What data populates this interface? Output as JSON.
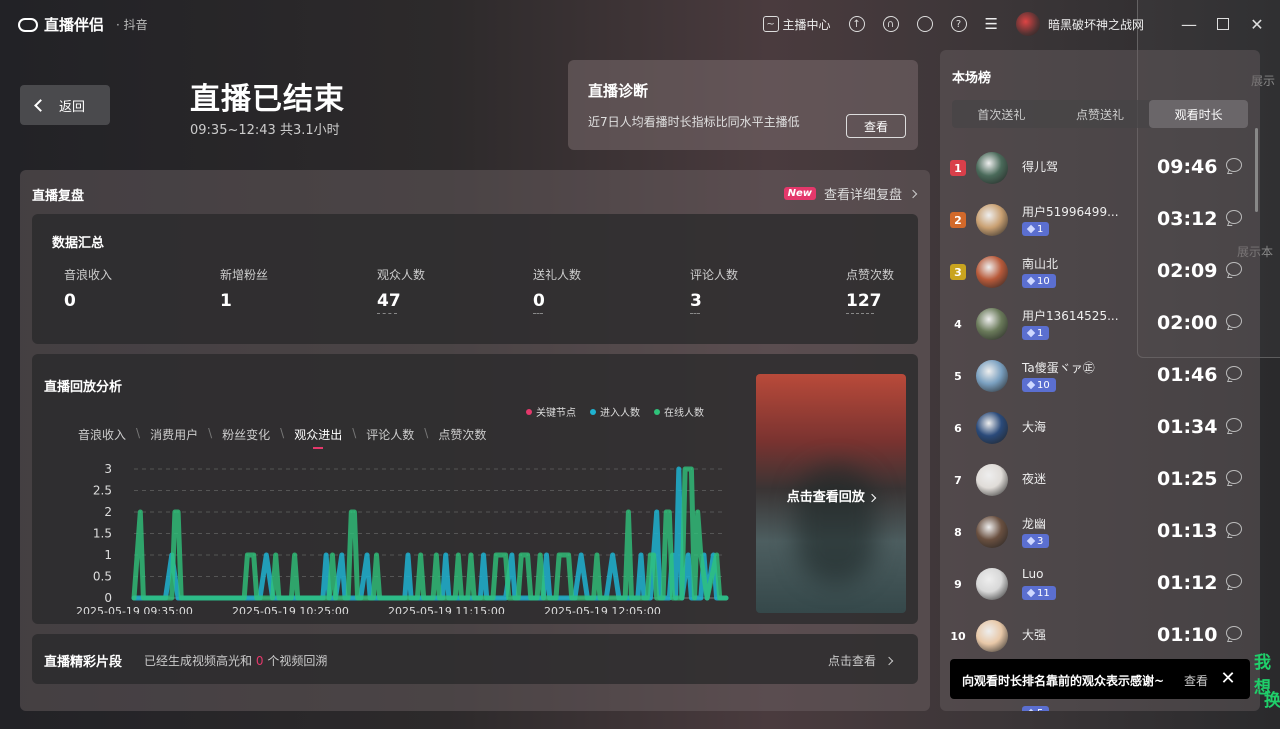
{
  "titlebar": {
    "app_name": "直播伴侣",
    "platform": "· 抖音",
    "anchor_center": "主播中心",
    "username": "暗黑破坏神之战网"
  },
  "header": {
    "back_label": "返回",
    "title": "直播已结束",
    "time_range": "09:35~12:43 共3.1小时"
  },
  "diagnosis": {
    "title": "直播诊断",
    "desc": "近7日人均看播时长指标比同水平主播低",
    "button": "查看"
  },
  "review": {
    "title": "直播复盘",
    "new_badge": "New",
    "detail_link": "查看详细复盘"
  },
  "summary": {
    "title": "数据汇总",
    "stats": [
      {
        "label": "音浪收入",
        "value": "0"
      },
      {
        "label": "新增粉丝",
        "value": "1"
      },
      {
        "label": "观众人数",
        "value": "47"
      },
      {
        "label": "送礼人数",
        "value": "0"
      },
      {
        "label": "评论人数",
        "value": "3"
      },
      {
        "label": "点赞次数",
        "value": "127"
      }
    ]
  },
  "analysis": {
    "title": "直播回放分析",
    "legend": [
      {
        "name": "关键节点",
        "color": "#e4386b"
      },
      {
        "name": "进入人数",
        "color": "#1fb2d0"
      },
      {
        "name": "在线人数",
        "color": "#2fc27a"
      }
    ],
    "tabs": [
      "音浪收入",
      "消费用户",
      "粉丝变化",
      "观众进出",
      "评论人数",
      "点赞次数"
    ],
    "active_tab": 3,
    "replay_label": "点击查看回放"
  },
  "chart_data": {
    "type": "line",
    "title": "",
    "xlabel": "",
    "ylabel": "",
    "x_tick_labels": [
      "2025-05-19 09:35:00",
      "2025-05-19 10:25:00",
      "2025-05-19 11:15:00",
      "2025-05-19 12:05:00"
    ],
    "y_tick_labels": [
      "0",
      "0.5",
      "1",
      "1.5",
      "2",
      "2.5",
      "3"
    ],
    "ylim": [
      0,
      3
    ],
    "x_minutes_range": [
      0,
      188
    ],
    "grid": true,
    "series": [
      {
        "name": "进入人数",
        "color": "#1fb2d0",
        "points": [
          [
            0,
            0
          ],
          [
            10,
            0
          ],
          [
            12,
            1
          ],
          [
            14,
            0
          ],
          [
            40,
            0
          ],
          [
            42,
            1
          ],
          [
            44,
            0
          ],
          [
            60,
            0
          ],
          [
            61,
            1
          ],
          [
            62,
            0
          ],
          [
            64,
            0
          ],
          [
            66,
            1
          ],
          [
            67,
            0
          ],
          [
            72,
            0
          ],
          [
            74,
            1
          ],
          [
            75,
            0
          ],
          [
            86,
            0
          ],
          [
            87,
            1
          ],
          [
            88,
            0
          ],
          [
            98,
            0
          ],
          [
            99,
            1
          ],
          [
            100,
            0
          ],
          [
            110,
            0
          ],
          [
            111,
            1
          ],
          [
            112,
            0
          ],
          [
            118,
            0
          ],
          [
            120,
            1
          ],
          [
            121,
            0
          ],
          [
            130,
            0
          ],
          [
            131,
            1
          ],
          [
            132,
            0
          ],
          [
            140,
            0
          ],
          [
            142,
            1
          ],
          [
            144,
            0
          ],
          [
            150,
            0
          ],
          [
            152,
            1
          ],
          [
            154,
            0
          ],
          [
            160,
            0
          ],
          [
            161,
            1
          ],
          [
            162,
            0
          ],
          [
            164,
            0
          ],
          [
            166,
            2
          ],
          [
            167,
            0
          ],
          [
            170,
            0
          ],
          [
            171,
            1
          ],
          [
            172,
            0
          ],
          [
            173,
            3
          ],
          [
            174,
            0
          ],
          [
            176,
            1
          ],
          [
            177,
            0
          ],
          [
            180,
            0
          ],
          [
            181,
            1
          ],
          [
            182,
            0
          ],
          [
            184,
            1
          ],
          [
            185,
            0
          ],
          [
            188,
            0
          ]
        ]
      },
      {
        "name": "在线人数",
        "color": "#2fc27a",
        "points": [
          [
            0,
            0
          ],
          [
            2,
            2
          ],
          [
            3,
            0
          ],
          [
            12,
            0
          ],
          [
            13,
            2
          ],
          [
            14,
            2
          ],
          [
            15,
            0
          ],
          [
            35,
            0
          ],
          [
            36,
            1
          ],
          [
            38,
            1
          ],
          [
            39,
            0
          ],
          [
            44,
            0
          ],
          [
            45,
            1
          ],
          [
            46,
            0
          ],
          [
            50,
            0
          ],
          [
            51,
            1
          ],
          [
            52,
            0
          ],
          [
            62,
            0
          ],
          [
            63,
            1
          ],
          [
            64,
            0
          ],
          [
            68,
            0
          ],
          [
            69,
            2
          ],
          [
            70,
            2
          ],
          [
            71,
            0
          ],
          [
            76,
            0
          ],
          [
            77,
            1
          ],
          [
            78,
            0
          ],
          [
            90,
            0
          ],
          [
            91,
            1
          ],
          [
            92,
            0
          ],
          [
            95,
            0
          ],
          [
            96,
            1
          ],
          [
            97,
            0
          ],
          [
            102,
            0
          ],
          [
            103,
            1
          ],
          [
            104,
            0
          ],
          [
            106,
            0
          ],
          [
            107,
            1
          ],
          [
            108,
            0
          ],
          [
            114,
            0
          ],
          [
            115,
            1
          ],
          [
            118,
            1
          ],
          [
            119,
            0
          ],
          [
            122,
            0
          ],
          [
            123,
            1
          ],
          [
            125,
            1
          ],
          [
            126,
            0
          ],
          [
            128,
            0
          ],
          [
            129,
            1
          ],
          [
            130,
            0
          ],
          [
            134,
            0
          ],
          [
            135,
            1
          ],
          [
            138,
            1
          ],
          [
            139,
            0
          ],
          [
            146,
            0
          ],
          [
            147,
            1
          ],
          [
            148,
            0
          ],
          [
            156,
            0
          ],
          [
            157,
            2
          ],
          [
            158,
            0
          ],
          [
            163,
            0
          ],
          [
            164,
            1
          ],
          [
            165,
            1
          ],
          [
            166,
            0
          ],
          [
            168,
            0
          ],
          [
            169,
            2
          ],
          [
            170,
            2
          ],
          [
            171,
            0
          ],
          [
            174,
            0
          ],
          [
            175,
            3
          ],
          [
            177,
            3
          ],
          [
            178,
            0
          ],
          [
            179,
            2
          ],
          [
            180,
            1
          ],
          [
            182,
            0
          ],
          [
            185,
            1
          ],
          [
            186,
            0
          ],
          [
            188,
            0
          ]
        ]
      }
    ]
  },
  "highlights": {
    "title": "直播精彩片段",
    "desc_prefix": "已经生成视频高光和",
    "count": "0",
    "desc_suffix": "个视频回溯",
    "link": "点击查看"
  },
  "ranking": {
    "title": "本场榜",
    "tabs": [
      "首次送礼",
      "点赞送礼",
      "观看时长"
    ],
    "active_tab": 2,
    "rows": [
      {
        "rank": "1",
        "name": "得儿驾",
        "badge": "",
        "time": "09:46",
        "rank_color": "#d93f4a",
        "avatar": "#4a6a5a"
      },
      {
        "rank": "2",
        "name": "用户51996499...",
        "badge": "1",
        "time": "03:12",
        "rank_color": "#d2692a",
        "avatar": "#c9a072"
      },
      {
        "rank": "3",
        "name": "南山北",
        "badge": "10",
        "time": "02:09",
        "rank_color": "#c9a41f",
        "avatar": "#b85a3a"
      },
      {
        "rank": "4",
        "name": "用户13614525...",
        "badge": "1",
        "time": "02:00",
        "rank_color": "",
        "avatar": "#6a7a5a"
      },
      {
        "rank": "5",
        "name": "Ta傻蛋ヾァ㊣",
        "badge": "10",
        "time": "01:46",
        "rank_color": "",
        "avatar": "#7aa0c0"
      },
      {
        "rank": "6",
        "name": "大海",
        "badge": "",
        "time": "01:34",
        "rank_color": "",
        "avatar": "#2a4a7a"
      },
      {
        "rank": "7",
        "name": "夜迷",
        "badge": "",
        "time": "01:25",
        "rank_color": "",
        "avatar": "#e0dcd8"
      },
      {
        "rank": "8",
        "name": "龙幽",
        "badge": "3",
        "time": "01:13",
        "rank_color": "",
        "avatar": "#6a5040"
      },
      {
        "rank": "9",
        "name": "Luo",
        "badge": "11",
        "time": "01:12",
        "rank_color": "",
        "avatar": "#d8d8d8"
      },
      {
        "rank": "10",
        "name": "大强",
        "badge": "",
        "time": "01:10",
        "rank_color": "",
        "avatar": "#e8c8a8"
      }
    ],
    "partial_badge": "5"
  },
  "thank_bar": {
    "text": "向观看时长排名靠前的观众表示感谢~",
    "view": "查看"
  },
  "overlay": {
    "text1": "展示",
    "text2": "展示本",
    "edge1": "我想",
    "edge2": "换"
  }
}
